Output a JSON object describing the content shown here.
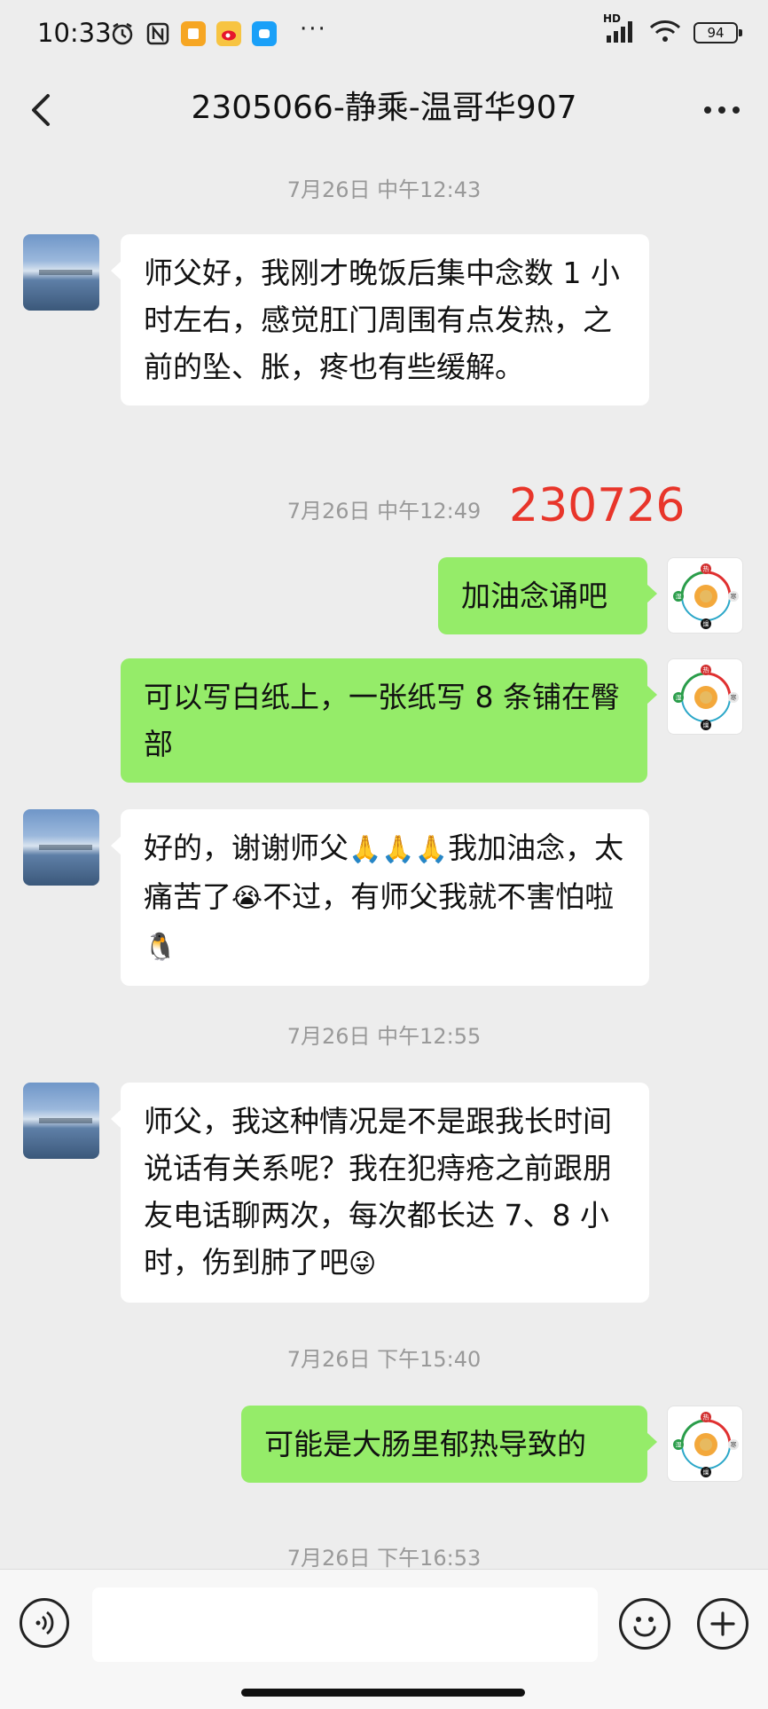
{
  "status_bar": {
    "time": "10:33",
    "network": "HD",
    "battery": "94"
  },
  "header": {
    "title": "2305066-静乘-温哥华907"
  },
  "messages": [
    {
      "type": "timestamp",
      "text": "7月26日 中午12:43"
    },
    {
      "type": "received",
      "text": "师父好，我刚才晚饭后集中念数 1 小时左右，感觉肛门周围有点发热，之前的坠、胀，疼也有些缓解。"
    },
    {
      "type": "timestamp",
      "text": "7月26日 中午12:49",
      "annotation": "230726"
    },
    {
      "type": "sent",
      "text": "加油念诵吧"
    },
    {
      "type": "sent",
      "text": "可以写白纸上，一张纸写 8 条铺在臀部"
    },
    {
      "type": "received",
      "text_a": "好的，谢谢师父",
      "emoji_a": "🙏🙏🙏",
      "text_b": "我加油念，太痛苦了",
      "emoji_b": "😭",
      "text_c": "不过，有师父我就不害怕啦",
      "emoji_c": "🐧"
    },
    {
      "type": "timestamp",
      "text": "7月26日 中午12:55"
    },
    {
      "type": "received",
      "text": "师父，我这种情况是不是跟我长时间说话有关系呢？我在犯痔疮之前跟朋友电话聊两次，每次都长达 7、8 小时，伤到肺了吧",
      "emoji": "😜"
    },
    {
      "type": "timestamp",
      "text": "7月26日 下午15:40"
    },
    {
      "type": "sent",
      "text": "可能是大肠里郁热导致的"
    },
    {
      "type": "timestamp",
      "text": "7月26日 下午16:53"
    }
  ],
  "avatar_logo_labels": {
    "top": "热",
    "left": "湿",
    "right": "寒",
    "bottom": "燥"
  },
  "icons": {
    "back": "chevron-left-icon",
    "more": "more-dots-icon",
    "voice": "voice-icon",
    "emoji": "emoji-icon",
    "plus": "plus-icon"
  },
  "colors": {
    "sent_bubble": "#95ec69",
    "received_bubble": "#ffffff",
    "annotation": "#e8352a",
    "background": "#ededed"
  }
}
